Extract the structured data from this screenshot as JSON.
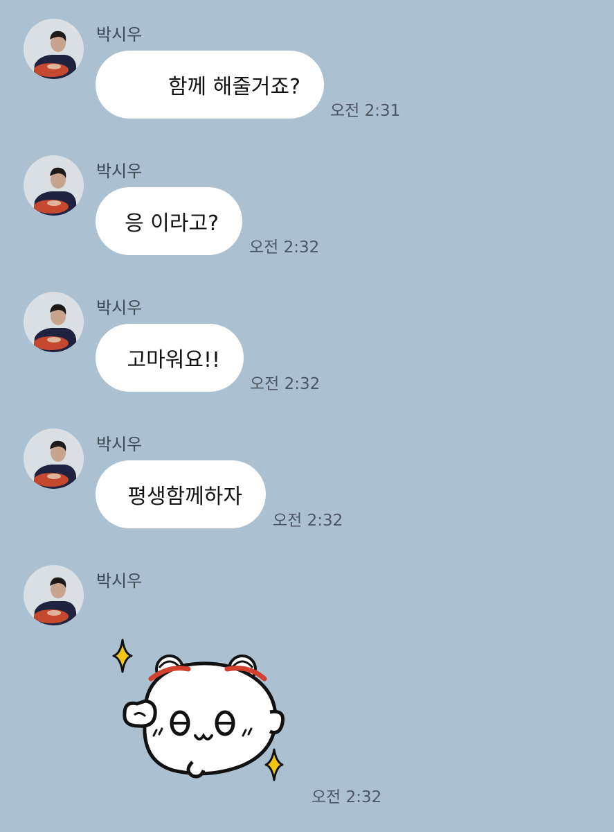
{
  "chat": {
    "background_color": "#abc1d1",
    "bubble_color": "#ffffff",
    "messages": [
      {
        "sender": "박시우",
        "avatar": "profile-photo",
        "text": "함께 해줄거죠?",
        "time": "오전 2:31"
      },
      {
        "sender": "박시우",
        "avatar": "profile-photo",
        "text": "응 이라고?",
        "time": "오전 2:32"
      },
      {
        "sender": "박시우",
        "avatar": "profile-photo",
        "text": "고마워요!!",
        "time": "오전 2:32"
      },
      {
        "sender": "박시우",
        "avatar": "profile-photo",
        "text": "평생함께하자",
        "time": "오전 2:32"
      },
      {
        "sender": "박시우",
        "avatar": "profile-photo",
        "sticker": "cute-white-character-sticker",
        "time": "오전 2:32"
      }
    ]
  }
}
